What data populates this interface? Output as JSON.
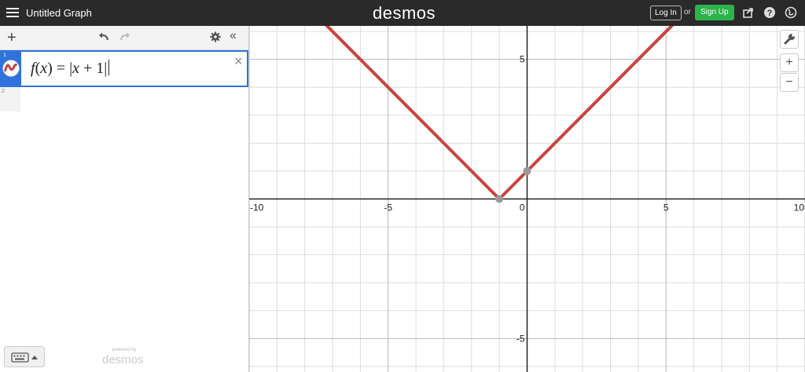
{
  "header": {
    "title": "Untitled Graph",
    "logo": "desmos",
    "login_label": "Log In",
    "or_label": "or",
    "signup_label": "Sign Up",
    "icons": [
      "menu-icon",
      "share-icon",
      "help-icon",
      "globe-icon"
    ]
  },
  "expressions": {
    "toolbar_icons": [
      "add-icon",
      "undo-icon",
      "redo-icon",
      "gear-icon",
      "collapse-icon"
    ],
    "add_label": "+",
    "collapse_label": "«",
    "items": [
      {
        "number": "1",
        "latex": {
          "f": "f",
          "lp": "(",
          "x": "x",
          "rp": ")",
          "eq": " = ",
          "bar1": "|",
          "x2": "x",
          "plus": " + 1",
          "bar2": "|"
        },
        "color": "#c74440"
      },
      {
        "number": "2"
      }
    ],
    "delete_label": "×"
  },
  "footer": {
    "powered_by": "powered by",
    "logo": "desmos"
  },
  "graph": {
    "zoom_in_label": "+",
    "zoom_out_label": "−",
    "axis_color": "#222222",
    "grid_color": "#dddddd",
    "major_grid_color": "#b8b8b8",
    "curve_color": "#c74440",
    "point_color": "#999999"
  },
  "chart_data": {
    "type": "line",
    "function": "f(x) = |x + 1|",
    "xlim": [
      -10,
      10
    ],
    "ylim": [
      -6.2,
      6.2
    ],
    "x_ticks": [
      -10,
      -5,
      0,
      5,
      10
    ],
    "y_ticks": [
      -5,
      5
    ],
    "x_tick_labels": [
      "-10",
      "-5",
      "0",
      "5",
      "10"
    ],
    "y_tick_labels": [
      "-5",
      "5"
    ],
    "grid": true,
    "series": [
      {
        "x": [
          -8,
          -1,
          6
        ],
        "y": [
          7,
          0,
          7
        ],
        "color": "#c74440"
      }
    ],
    "points": [
      {
        "x": -1,
        "y": 0
      },
      {
        "x": 0,
        "y": 1
      }
    ]
  }
}
